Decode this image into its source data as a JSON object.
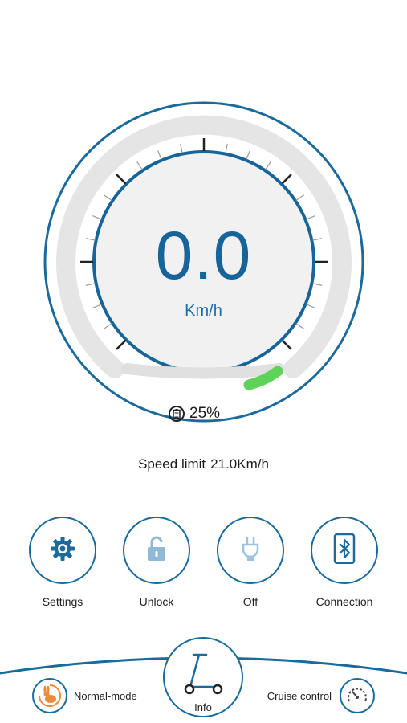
{
  "dashboard": {
    "speed_value": "0.0",
    "speed_unit": "Km/h",
    "battery_percent_text": "25%",
    "colors": {
      "accent": "#17649a",
      "ring": "#1a6a9c",
      "track": "#e4e4e4",
      "battery_fill": "#5ed35a"
    }
  },
  "speed_limit": {
    "label": "Speed limit",
    "value": "21.0Km/h"
  },
  "controls": [
    {
      "label": "Settings",
      "icon": "gear-icon"
    },
    {
      "label": "Unlock",
      "icon": "unlock-icon"
    },
    {
      "label": "Off",
      "icon": "light-icon"
    },
    {
      "label": "Connection",
      "icon": "bluetooth-icon"
    }
  ],
  "bottom_bar": {
    "left_mode_label": "Normal-mode",
    "left_mode_icon": "rabbit-icon",
    "center_label": "Info",
    "center_icon": "scooter-icon",
    "right_mode_label": "Cruise control",
    "right_mode_icon": "speedometer-icon"
  }
}
